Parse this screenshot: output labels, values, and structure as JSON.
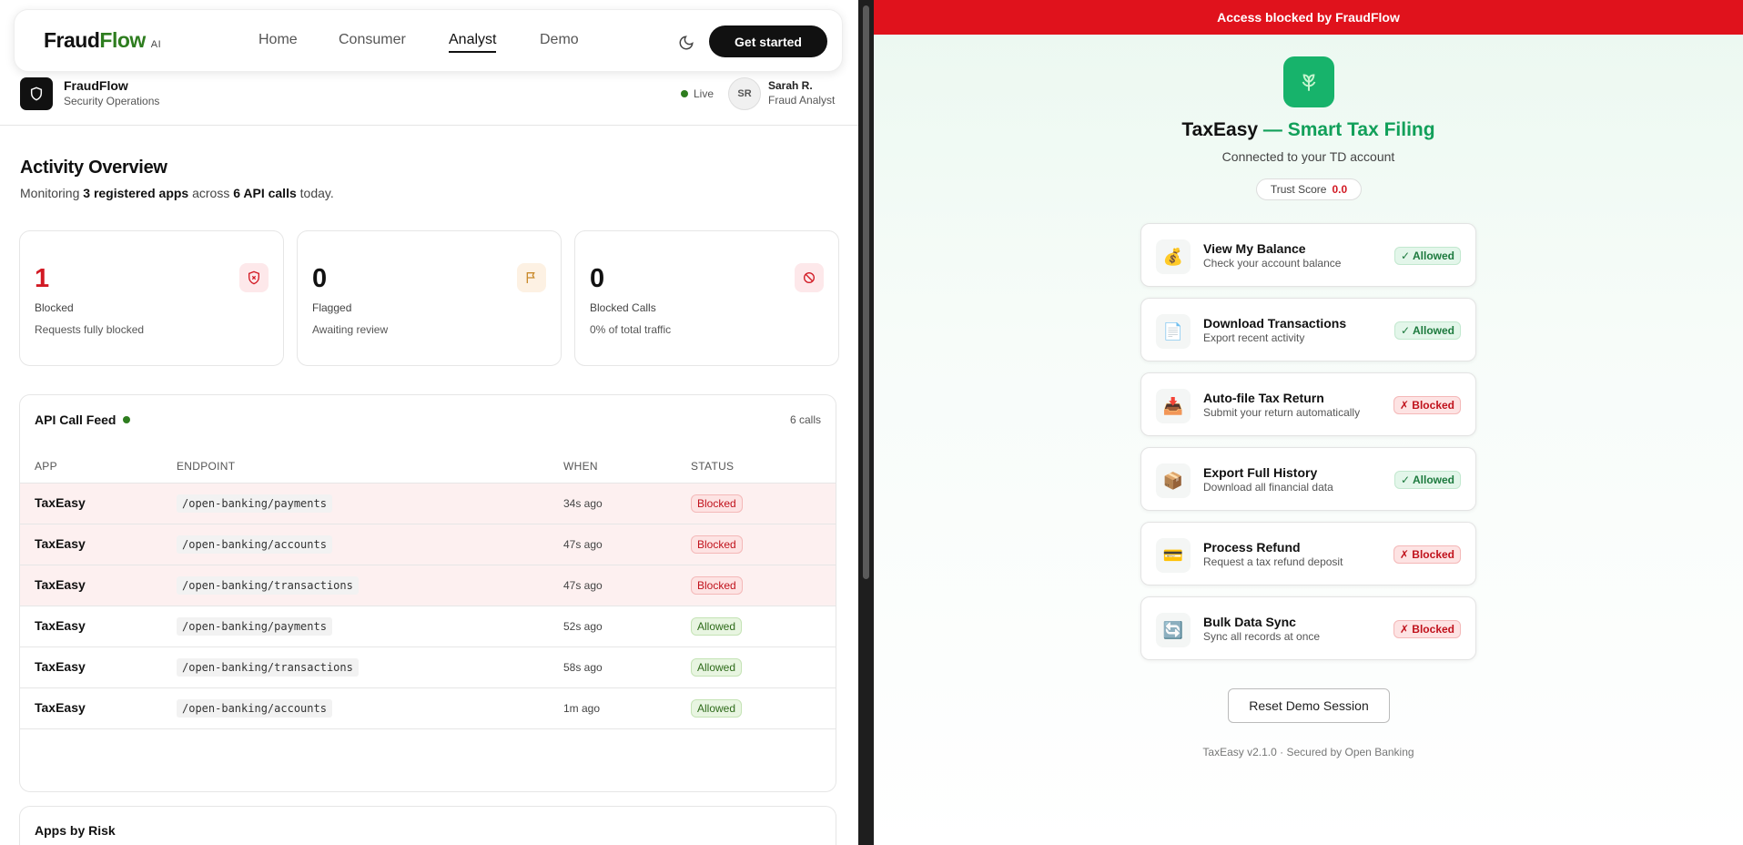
{
  "nav": {
    "brand_main": "Fraud",
    "brand_accent": "Flow",
    "brand_suffix": "AI",
    "links": [
      "Home",
      "Consumer",
      "Analyst",
      "Demo"
    ],
    "active_link": "Analyst",
    "cta": "Get started"
  },
  "org": {
    "name": "FraudFlow",
    "subtitle": "Security Operations",
    "live": "Live",
    "user_initials": "SR",
    "user_name": "Sarah R.",
    "user_role": "Fraud Analyst"
  },
  "overview": {
    "title": "Activity Overview",
    "sub_prefix": "Monitoring",
    "sub_apps": "3 registered apps",
    "sub_mid": "across",
    "sub_calls": "6 API calls",
    "sub_suffix": "today."
  },
  "stats": [
    {
      "value": "1",
      "label": "Blocked",
      "desc": "Requests fully blocked",
      "icon": "shield-x-icon",
      "accent": "#d21a24"
    },
    {
      "value": "0",
      "label": "Flagged",
      "desc": "Awaiting review",
      "icon": "flag-icon",
      "accent": "#c98a2b"
    },
    {
      "value": "0",
      "label": "Blocked Calls",
      "desc": "0% of total traffic",
      "icon": "ban-icon",
      "accent": "#d21a24"
    }
  ],
  "feed": {
    "title": "API Call Feed",
    "count": "6 calls",
    "headers": [
      "APP",
      "ENDPOINT",
      "WHEN",
      "STATUS"
    ],
    "rows": [
      {
        "app": "TaxEasy",
        "endpoint": "/open-banking/payments",
        "when": "34s ago",
        "status": "Blocked"
      },
      {
        "app": "TaxEasy",
        "endpoint": "/open-banking/accounts",
        "when": "47s ago",
        "status": "Blocked"
      },
      {
        "app": "TaxEasy",
        "endpoint": "/open-banking/transactions",
        "when": "47s ago",
        "status": "Blocked"
      },
      {
        "app": "TaxEasy",
        "endpoint": "/open-banking/payments",
        "when": "52s ago",
        "status": "Allowed"
      },
      {
        "app": "TaxEasy",
        "endpoint": "/open-banking/transactions",
        "when": "58s ago",
        "status": "Allowed"
      },
      {
        "app": "TaxEasy",
        "endpoint": "/open-banking/accounts",
        "when": "1m ago",
        "status": "Allowed"
      }
    ]
  },
  "risk": {
    "title": "Apps by Risk"
  },
  "taxeasy": {
    "banner": "Access blocked by FraudFlow",
    "logo_icon": "leaf-icon",
    "title_main": "TaxEasy",
    "title_accent": "— Smart Tax Filing",
    "subtitle": "Connected to your TD account",
    "trust_label": "Trust Score",
    "trust_value": "0.0",
    "permissions": [
      {
        "title": "View My Balance",
        "desc": "Check your account balance",
        "icon": "money-bag-icon",
        "glyph": "💰",
        "status": "✓ Allowed",
        "kind": "allowed"
      },
      {
        "title": "Download Transactions",
        "desc": "Export recent activity",
        "icon": "document-icon",
        "glyph": "📄",
        "status": "✓ Allowed",
        "kind": "allowed"
      },
      {
        "title": "Auto-file Tax Return",
        "desc": "Submit your return automatically",
        "icon": "inbox-tray-icon",
        "glyph": "📥",
        "status": "✗ Blocked",
        "kind": "blocked"
      },
      {
        "title": "Export Full History",
        "desc": "Download all financial data",
        "icon": "package-icon",
        "glyph": "📦",
        "status": "✓ Allowed",
        "kind": "allowed"
      },
      {
        "title": "Process Refund",
        "desc": "Request a tax refund deposit",
        "icon": "credit-card-icon",
        "glyph": "💳",
        "status": "✗ Blocked",
        "kind": "blocked"
      },
      {
        "title": "Bulk Data Sync",
        "desc": "Sync all records at once",
        "icon": "sync-icon",
        "glyph": "🔄",
        "status": "✗ Blocked",
        "kind": "blocked"
      }
    ],
    "reset": "Reset Demo Session",
    "footer": "TaxEasy v2.1.0 · Secured by Open Banking"
  },
  "colors": {
    "brand_green": "#2e7d1f",
    "taxeasy_green": "#12a05a",
    "banner_red": "#e0121c"
  }
}
